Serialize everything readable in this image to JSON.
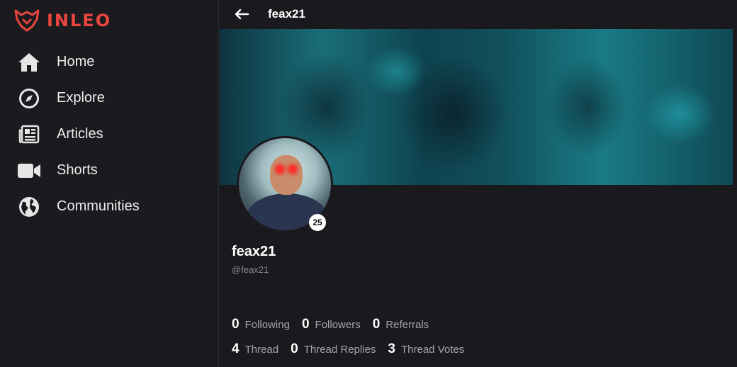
{
  "brand": {
    "name": "INLEO",
    "color": "#e8463f"
  },
  "nav": [
    {
      "label": "Home",
      "icon": "home-icon"
    },
    {
      "label": "Explore",
      "icon": "compass-icon"
    },
    {
      "label": "Articles",
      "icon": "newspaper-icon"
    },
    {
      "label": "Shorts",
      "icon": "video-icon"
    },
    {
      "label": "Communities",
      "icon": "globe-icon"
    }
  ],
  "topbar": {
    "title": "feax21",
    "back_icon": "arrow-left-icon"
  },
  "profile": {
    "name": "feax21",
    "handle": "@feax21",
    "level": "25"
  },
  "stats": {
    "row1": [
      {
        "value": "0",
        "label": "Following"
      },
      {
        "value": "0",
        "label": "Followers"
      },
      {
        "value": "0",
        "label": "Referrals"
      }
    ],
    "row2": [
      {
        "value": "4",
        "label": "Thread"
      },
      {
        "value": "0",
        "label": "Thread Replies"
      },
      {
        "value": "3",
        "label": "Thread Votes"
      }
    ]
  }
}
